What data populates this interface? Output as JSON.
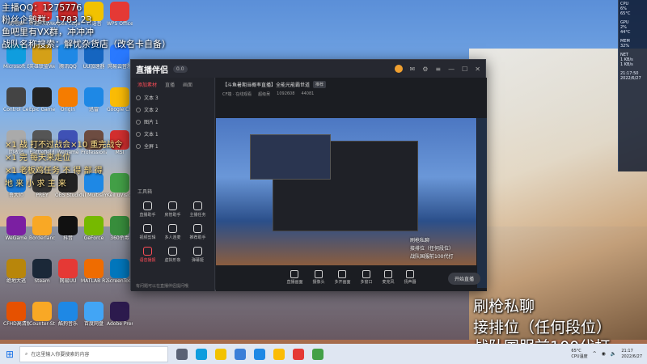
{
  "overlay": {
    "lines_top": [
      "主播QQ：1275776",
      "粉丝企鹅群：1783    23",
      "鱼吧里有VX群，冲冲冲",
      "战队名称搜索：解忧杂货店（改名卡自备）"
    ],
    "lines_mid": [
      "×1 战 打不过战会×10 重完战令",
      "×1 完 每天来走位",
      "×1 老板鸡任务 不 得 部 得",
      "地 来 小 求 主 来"
    ],
    "lines_bottom": [
      "刷枪私聊",
      "接排位（任何段位）",
      "战队国服前100代打"
    ]
  },
  "desktop_icons": [
    {
      "label": "此电脑",
      "color": "#3b7fd8"
    },
    {
      "label": "穿越火线WeGame",
      "color": "#d33"
    },
    {
      "label": "Apex Legends",
      "color": "#c62828"
    },
    {
      "label": "YY语音",
      "color": "#f2c200"
    },
    {
      "label": "WPS Office",
      "color": "#e53935"
    },
    {
      "label": "Microsoft Edge",
      "color": "#0f9dde"
    },
    {
      "label": "英雄联盟WeGame",
      "color": "#d4a017"
    },
    {
      "label": "腾讯QQ",
      "color": "#1e88e5"
    },
    {
      "label": "UU加速器",
      "color": "#1565c0"
    },
    {
      "label": "网易云音乐",
      "color": "#2979ff"
    },
    {
      "label": "Control Center 3.0",
      "color": "#444"
    },
    {
      "label": "Epic Games Launcher",
      "color": "#222"
    },
    {
      "label": "Origin",
      "color": "#f57c00"
    },
    {
      "label": "迅雷",
      "color": "#1e88e5"
    },
    {
      "label": "Google Chrome",
      "color": "#fbbc05"
    },
    {
      "label": "回收站",
      "color": "#aaa"
    },
    {
      "label": "Battlefield",
      "color": "#555"
    },
    {
      "label": "WeGame",
      "color": "#3f51b5"
    },
    {
      "label": "Professional",
      "color": "#6d4c41"
    },
    {
      "label": "MSI",
      "color": "#d32f2f"
    },
    {
      "label": "鲁大师",
      "color": "#1976d2"
    },
    {
      "label": "PREY",
      "color": "#333"
    },
    {
      "label": "OBS Studio",
      "color": "#222"
    },
    {
      "label": "NI Multisim",
      "color": "#1e88e5"
    },
    {
      "label": "Keil uVision5",
      "color": "#43a047"
    },
    {
      "label": "WeGame",
      "color": "#7b1fa2"
    },
    {
      "label": "Borderlands 3",
      "color": "#f9a825"
    },
    {
      "label": "抖音",
      "color": "#111"
    },
    {
      "label": "GeForce",
      "color": "#76b900"
    },
    {
      "label": "360杀毒",
      "color": "#388e3c"
    },
    {
      "label": "绝地大逃",
      "color": "#b8860b"
    },
    {
      "label": "Steam",
      "color": "#1b2838"
    },
    {
      "label": "网易UU",
      "color": "#e53935"
    },
    {
      "label": "MATLAB R2016a",
      "color": "#ef6c00"
    },
    {
      "label": "ScreenToGif",
      "color": "#0277bd"
    },
    {
      "label": "CFHD高清版",
      "color": "#e65100"
    },
    {
      "label": "Counter-Strike Global Off",
      "color": "#f9a825"
    },
    {
      "label": "酷狗音乐",
      "color": "#1e88e5"
    },
    {
      "label": "百度网盘",
      "color": "#42a5f5"
    },
    {
      "label": "Adobe Premiere",
      "color": "#2c1a4d"
    }
  ],
  "app": {
    "title": "直播伴侣",
    "version": "0.0",
    "side_tabs": [
      "添加素材",
      "直播",
      "画面"
    ],
    "sources": [
      "文本 3",
      "文本 2",
      "图片 1",
      "文本 1",
      "全屏 1"
    ],
    "tools_heading": "工具箱",
    "tools": [
      {
        "label": "直播助手",
        "active": false
      },
      {
        "label": "房管助手",
        "active": false
      },
      {
        "label": "主播任务",
        "active": false
      },
      {
        "label": "视频剪辑",
        "active": false
      },
      {
        "label": "多人连麦",
        "active": false
      },
      {
        "label": "推荐助手",
        "active": false
      },
      {
        "label": "语音播报",
        "active": true
      },
      {
        "label": "虚拟形象",
        "active": false
      },
      {
        "label": "弹幕姬",
        "active": false
      }
    ],
    "side_footer": "有问题可以在直播伴侣提问哦",
    "room_title": "【斗鱼暑期当概率直播】全能光能霸世道",
    "room_tag": "推荐",
    "room_sub": [
      "CF端 · 在线观看",
      "超级吴",
      "1092608",
      "44081"
    ],
    "controls": [
      "直播画面",
      "摄像头",
      "多开画面",
      "多窗口",
      "麦克风",
      "扬声器"
    ],
    "start_btn": "开始直播"
  },
  "preview": {
    "label_line1": "刷枪私聊",
    "label_line2": "接排位（任何段位）",
    "label_line3": "战队国服前100代打"
  },
  "meter": {
    "cpu": "CPU",
    "cpu_v": "6%",
    "cpu_t": "65°C",
    "gpu": "GPU",
    "gpu_v": "2%",
    "gpu_t": "44°C",
    "mem": "MEM",
    "mem_v": "32%",
    "net": "NET",
    "net_up": "1 KB/s",
    "net_down": "1 KB/s",
    "time": "21:17:50",
    "date": "2022/6/27"
  },
  "taskbar": {
    "search_placeholder": "在这里输入你要搜索的内容",
    "weather_temp": "65°C",
    "weather_text": "CPU温度",
    "time": "21:17",
    "date": "2022/6/27"
  }
}
